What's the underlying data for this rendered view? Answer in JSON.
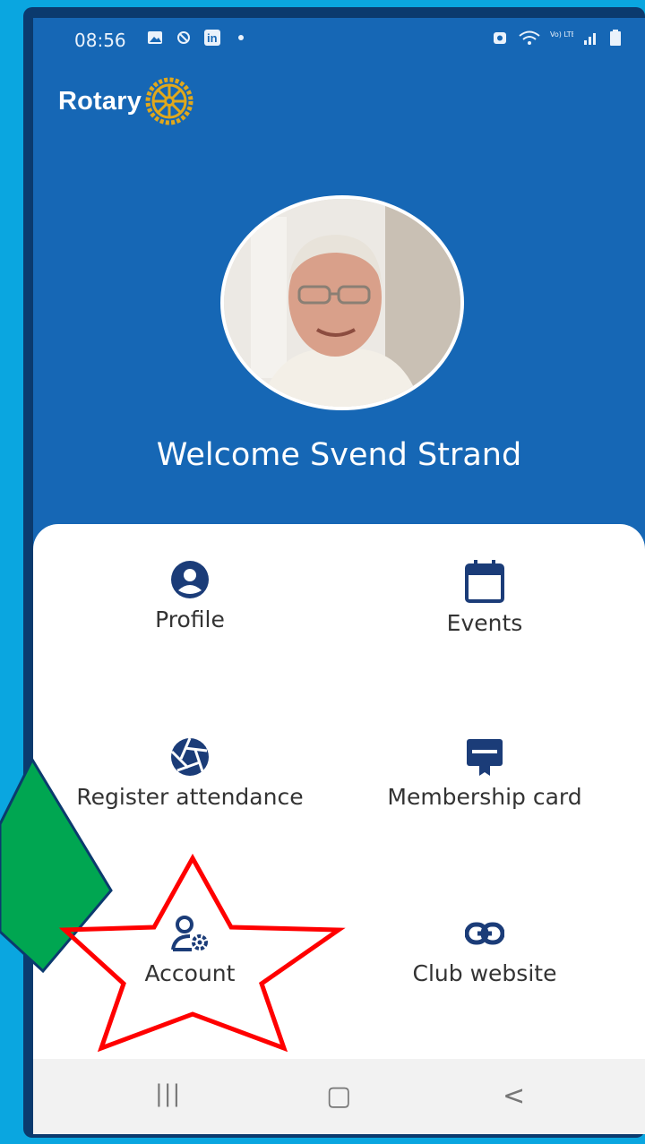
{
  "status_bar": {
    "time": "08:56",
    "icons_left": [
      "image-icon",
      "sync-icon",
      "linkedin-icon",
      "dot-icon"
    ],
    "icons_right": [
      "alarm-icon",
      "wifi-icon",
      "volte-icon",
      "signal-icon",
      "battery-icon"
    ],
    "linkedin_text": "in",
    "volte_text": "Vo) LTE1"
  },
  "header": {
    "brand": "Rotary",
    "logo_icon": "rotary-wheel-icon"
  },
  "profile": {
    "welcome": "Welcome Svend Strand"
  },
  "menu": [
    {
      "label": "Profile",
      "icon": "user-circle-icon"
    },
    {
      "label": "Events",
      "icon": "calendar-icon"
    },
    {
      "label": "Register attendance",
      "icon": "camera-shutter-icon"
    },
    {
      "label": "Membership card",
      "icon": "membership-card-icon"
    },
    {
      "label": "Account",
      "icon": "account-settings-icon"
    },
    {
      "label": "Club website",
      "icon": "link-icon"
    }
  ],
  "nav": {
    "recent": "|||",
    "home": "▢",
    "back": "<"
  },
  "colors": {
    "background": "#0aa6e0",
    "app_blue": "#1667b5",
    "icon_navy": "#1b3c78",
    "arrow_green": "#00a651",
    "star_red": "#ff0000"
  }
}
